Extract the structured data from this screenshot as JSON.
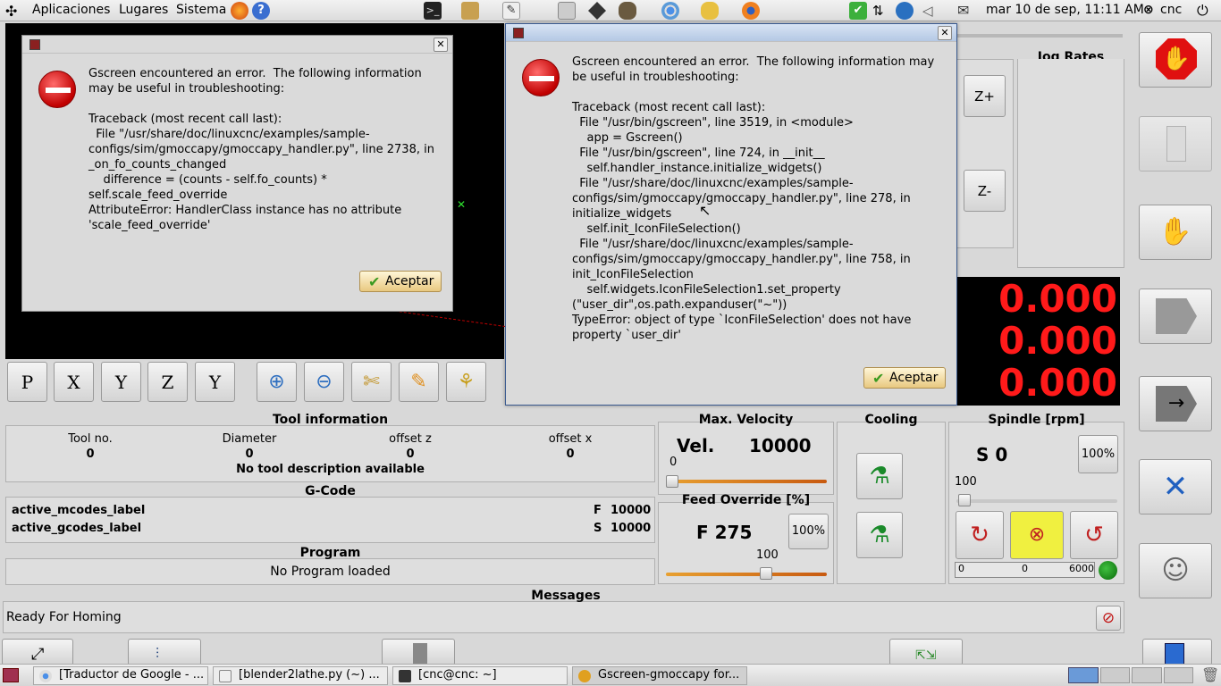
{
  "top_panel": {
    "menus": [
      "Aplicaciones",
      "Lugares",
      "Sistema"
    ],
    "clock": "mar 10 de sep, 11:11 AM",
    "user": "cnc"
  },
  "taskbar": {
    "tasks": [
      "[Traductor de Google - ...",
      "[blender2lathe.py (~) ...",
      "[cnc@cnc: ~]",
      "Gscreen-gmoccapy for..."
    ]
  },
  "toolbar": {
    "view_buttons": [
      "P",
      "X",
      "Y",
      "Z",
      "Y"
    ]
  },
  "jog": {
    "title": "Jog Rates",
    "z_plus": "Z+",
    "z_minus": "Z-"
  },
  "dro": {
    "values": [
      "0.000",
      "0.000",
      "0.000"
    ]
  },
  "tool_info": {
    "title": "Tool information",
    "cols": [
      {
        "label": "Tool no.",
        "value": "0"
      },
      {
        "label": "Diameter",
        "value": "0"
      },
      {
        "label": "offset z",
        "value": "0"
      },
      {
        "label": "offset x",
        "value": "0"
      }
    ],
    "description": "No tool description available"
  },
  "gcode": {
    "title": "G-Code",
    "mcodes": "active_mcodes_label",
    "gcodes": "active_gcodes_label",
    "f_label": "F",
    "f_value": "10000",
    "s_label": "S",
    "s_value": "10000"
  },
  "program": {
    "title": "Program",
    "text": "No Program loaded"
  },
  "max_velocity": {
    "title": "Max. Velocity",
    "label": "Vel.",
    "value": "10000",
    "min": "0",
    "level": 1.0
  },
  "feed_override": {
    "title": "Feed Override [%]",
    "value": "F 275",
    "reset": "100%",
    "scale": "100",
    "level": 0.6
  },
  "cooling": {
    "title": "Cooling"
  },
  "spindle": {
    "title": "Spindle [rpm]",
    "value": "S 0",
    "reset": "100%",
    "scale": "100",
    "bar_min": "0",
    "bar_mid": "0",
    "bar_max": "6000",
    "level": 0.0
  },
  "messages": {
    "title": "Messages",
    "text": "Ready For Homing"
  },
  "dialog1": {
    "message": "Gscreen encountered an error.  The following information may be useful in troubleshooting:\n\nTraceback (most recent call last):\n  File \"/usr/share/doc/linuxcnc/examples/sample-configs/sim/gmoccapy/gmoccapy_handler.py\", line 2738, in _on_fo_counts_changed\n    difference = (counts - self.fo_counts) * self.scale_feed_override\nAttributeError: HandlerClass instance has no attribute 'scale_feed_override'",
    "button": "Aceptar"
  },
  "dialog2": {
    "message": "Gscreen encountered an error.  The following information may be useful in troubleshooting:\n\nTraceback (most recent call last):\n  File \"/usr/bin/gscreen\", line 3519, in <module>\n    app = Gscreen()\n  File \"/usr/bin/gscreen\", line 724, in __init__\n    self.handler_instance.initialize_widgets()\n  File \"/usr/share/doc/linuxcnc/examples/sample-configs/sim/gmoccapy/gmoccapy_handler.py\", line 278, in initialize_widgets\n    self.init_IconFileSelection()\n  File \"/usr/share/doc/linuxcnc/examples/sample-configs/sim/gmoccapy/gmoccapy_handler.py\", line 758, in init_IconFileSelection\n    self.widgets.IconFileSelection1.set_property (\"user_dir\",os.path.expanduser(\"~\"))\nTypeError: object of type `IconFileSelection' does not have property `user_dir'",
    "button": "Aceptar"
  }
}
